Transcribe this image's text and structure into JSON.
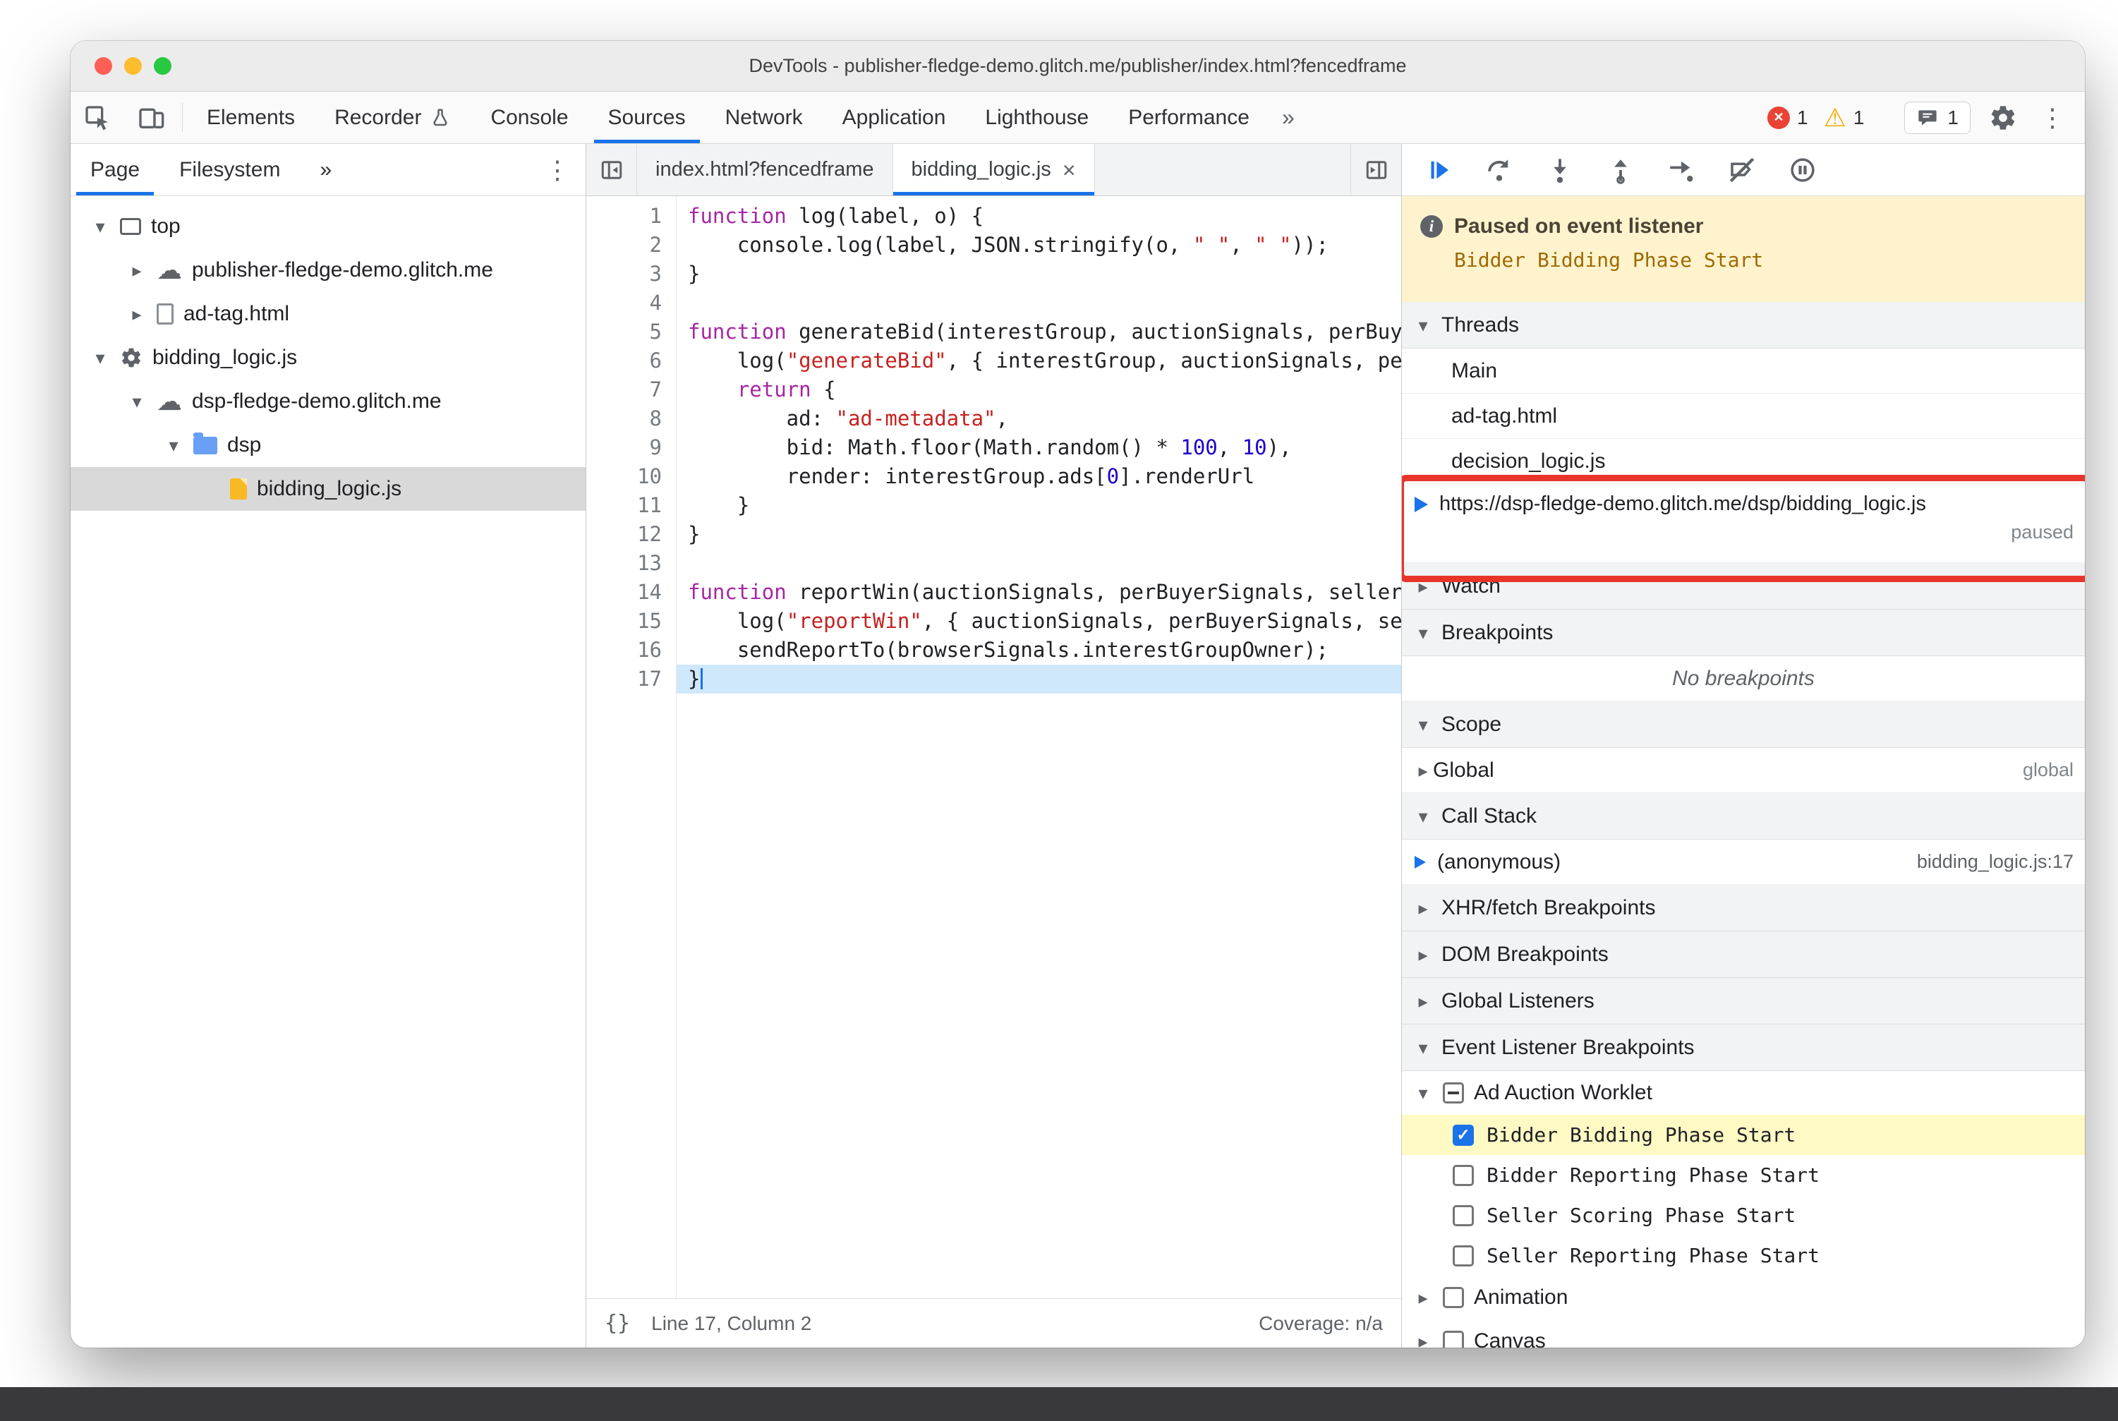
{
  "window": {
    "title": "DevTools - publisher-fledge-demo.glitch.me/publisher/index.html?fencedframe"
  },
  "icons": {
    "overflow_chevron": "»",
    "kebab_menu": "⋮"
  },
  "toolbar": {
    "tabs": [
      "Elements",
      "Recorder",
      "Console",
      "Sources",
      "Network",
      "Application",
      "Lighthouse",
      "Performance"
    ],
    "error_count": "1",
    "warning_count": "1",
    "message_count": "1"
  },
  "sidebar": {
    "tabs": {
      "page": "Page",
      "filesystem": "Filesystem"
    },
    "tree": [
      {
        "label": "top"
      },
      {
        "label": "publisher-fledge-demo.glitch.me"
      },
      {
        "label": "ad-tag.html"
      },
      {
        "label": "bidding_logic.js"
      },
      {
        "label": "dsp-fledge-demo.glitch.me"
      },
      {
        "label": "dsp"
      },
      {
        "label": "bidding_logic.js"
      }
    ]
  },
  "editor": {
    "tabs": [
      {
        "label": "index.html?fencedframe"
      },
      {
        "label": "bidding_logic.js"
      }
    ],
    "status": {
      "pretty": "{}",
      "line_col": "Line 17, Column 2",
      "coverage": "Coverage: n/a"
    },
    "code": {
      "active_line": 17,
      "lines": [
        [
          {
            "t": "function",
            "c": "kw"
          },
          {
            "t": " log(label, o) {",
            "c": "pl"
          }
        ],
        [
          {
            "t": "    console.log(label, JSON.stringify(o, ",
            "c": "pl"
          },
          {
            "t": "\" \"",
            "c": "str"
          },
          {
            "t": ", ",
            "c": "pl"
          },
          {
            "t": "\" \"",
            "c": "str"
          },
          {
            "t": "));",
            "c": "pl"
          }
        ],
        [
          {
            "t": "}",
            "c": "pl"
          }
        ],
        [],
        [
          {
            "t": "function",
            "c": "kw"
          },
          {
            "t": " generateBid(interestGroup, auctionSignals, perBuyerSignals, trustedBiddingSignals, browserSignals) {",
            "c": "pl"
          }
        ],
        [
          {
            "t": "    log(",
            "c": "pl"
          },
          {
            "t": "\"generateBid\"",
            "c": "str"
          },
          {
            "t": ", { interestGroup, auctionSignals, perBuyerSignals, trustedBiddingSignals, browserSignals });",
            "c": "pl"
          }
        ],
        [
          {
            "t": "    ",
            "c": "pl"
          },
          {
            "t": "return",
            "c": "kw"
          },
          {
            "t": " {",
            "c": "pl"
          }
        ],
        [
          {
            "t": "        ad: ",
            "c": "pl"
          },
          {
            "t": "\"ad-metadata\"",
            "c": "str"
          },
          {
            "t": ",",
            "c": "pl"
          }
        ],
        [
          {
            "t": "        bid: Math.floor(Math.random() * ",
            "c": "pl"
          },
          {
            "t": "100",
            "c": "num"
          },
          {
            "t": ", ",
            "c": "pl"
          },
          {
            "t": "10",
            "c": "num"
          },
          {
            "t": "),",
            "c": "pl"
          }
        ],
        [
          {
            "t": "        render: interestGroup.ads[",
            "c": "pl"
          },
          {
            "t": "0",
            "c": "num"
          },
          {
            "t": "].renderUrl",
            "c": "pl"
          }
        ],
        [
          {
            "t": "    }",
            "c": "pl"
          }
        ],
        [
          {
            "t": "}",
            "c": "pl"
          }
        ],
        [],
        [
          {
            "t": "function",
            "c": "kw"
          },
          {
            "t": " reportWin(auctionSignals, perBuyerSignals, sellerSignals, browserSignals) {",
            "c": "pl"
          }
        ],
        [
          {
            "t": "    log(",
            "c": "pl"
          },
          {
            "t": "\"reportWin\"",
            "c": "str"
          },
          {
            "t": ", { auctionSignals, perBuyerSignals, sellerSignals, browserSignals });",
            "c": "pl"
          }
        ],
        [
          {
            "t": "    sendReportTo(browserSignals.interestGroupOwner);",
            "c": "pl"
          }
        ],
        [
          {
            "t": "}",
            "c": "pl"
          }
        ]
      ]
    }
  },
  "debugger": {
    "paused_banner": {
      "title": "Paused on event listener",
      "detail": "Bidder Bidding Phase Start"
    },
    "threads": {
      "title": "Threads",
      "items": [
        "Main",
        "ad-tag.html",
        "decision_logic.js"
      ],
      "active": {
        "url": "https://dsp-fledge-demo.glitch.me/dsp/bidding_logic.js",
        "status": "paused"
      }
    },
    "watch": {
      "title": "Watch"
    },
    "breakpoints": {
      "title": "Breakpoints",
      "empty": "No breakpoints"
    },
    "scope": {
      "title": "Scope",
      "row": {
        "label": "Global",
        "value": "global"
      }
    },
    "call_stack": {
      "title": "Call Stack",
      "row": {
        "label": "(anonymous)",
        "location": "bidding_logic.js:17"
      }
    },
    "xhr": {
      "title": "XHR/fetch Breakpoints"
    },
    "dom": {
      "title": "DOM Breakpoints"
    },
    "global_listeners": {
      "title": "Global Listeners"
    },
    "elb": {
      "title": "Event Listener Breakpoints",
      "category": {
        "label": "Ad Auction Worklet"
      },
      "events": [
        {
          "label": "Bidder Bidding Phase Start",
          "checked": true,
          "highlighted": true
        },
        {
          "label": "Bidder Reporting Phase Start",
          "checked": false
        },
        {
          "label": "Seller Scoring Phase Start",
          "checked": false
        },
        {
          "label": "Seller Reporting Phase Start",
          "checked": false
        }
      ],
      "more_categories": [
        {
          "label": "Animation"
        },
        {
          "label": "Canvas"
        }
      ]
    }
  }
}
